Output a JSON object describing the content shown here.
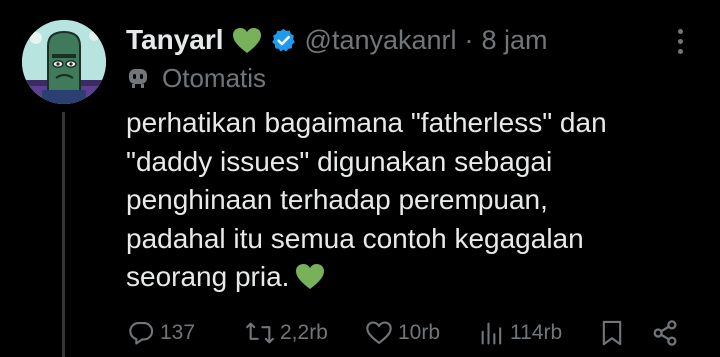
{
  "author": {
    "display_name": "Tanyarl",
    "handle": "@tanyakanrl",
    "separator": "·",
    "time": "8 jam",
    "automated_label": "Otomatis",
    "verified_color": "#1d9bf0",
    "heart_color": "#78b159",
    "avatar_icon": "cartoon-character-avatar"
  },
  "tweet": {
    "lines": [
      "perhatikan bagaimana \"fatherless\" dan",
      "\"daddy issues\" digunakan sebagai",
      "penghinaan terhadap perempuan,",
      "padahal itu semua contoh kegagalan",
      "seorang pria."
    ],
    "trailing_emoji": "green-heart"
  },
  "actions": {
    "replies": "137",
    "reposts": "2,2rb",
    "likes": "10rb",
    "views": "114rb"
  },
  "colors": {
    "background": "#000000",
    "text": "#e7e9ea",
    "muted": "#71767b"
  }
}
